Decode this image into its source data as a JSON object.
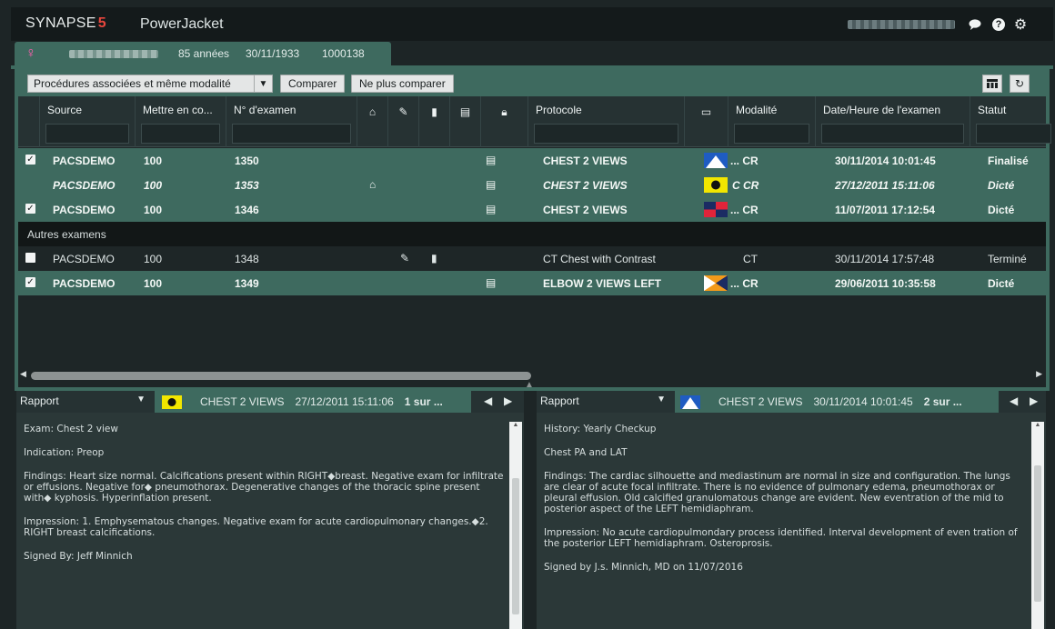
{
  "header": {
    "logo_text": "SYNAPSE",
    "logo_accent": "5",
    "app_name": "PowerJacket",
    "icons": [
      "chat-icon",
      "help-icon",
      "gear-icon"
    ]
  },
  "patient": {
    "age": "85 années",
    "dob": "30/11/1933",
    "id": "1000138"
  },
  "toolbar": {
    "filter_selected": "Procédures associées et même modalité",
    "compare_label": "Comparer",
    "no_compare_label": "Ne plus comparer"
  },
  "columns": {
    "source": "Source",
    "mettre": "Mettre en co...",
    "exam_no": "N° d'examen",
    "protocol": "Protocole",
    "modality": "Modalité",
    "datetime": "Date/Heure de l'examen",
    "status": "Statut"
  },
  "rows": [
    {
      "checked": true,
      "source": "PACSDEMO",
      "mettre": "100",
      "exam": "1350",
      "protocol": "CHEST 2 VIEWS",
      "modality": "... CR",
      "date": "30/11/2014 10:01:45",
      "status": "Finalisé"
    },
    {
      "checked": false,
      "source": "PACSDEMO",
      "mettre": "100",
      "exam": "1353",
      "protocol": "CHEST 2 VIEWS",
      "modality": "C CR",
      "date": "27/12/2011 15:11:06",
      "status": "Dicté"
    },
    {
      "checked": true,
      "source": "PACSDEMO",
      "mettre": "100",
      "exam": "1346",
      "protocol": "CHEST 2 VIEWS",
      "modality": "... CR",
      "date": "11/07/2011 17:12:54",
      "status": "Dicté"
    },
    {
      "checked": false,
      "source": "PACSDEMO",
      "mettre": "100",
      "exam": "1348",
      "protocol": "CT Chest with Contrast",
      "modality": "CT",
      "date": "30/11/2014 17:57:48",
      "status": "Terminé"
    },
    {
      "checked": true,
      "source": "PACSDEMO",
      "mettre": "100",
      "exam": "1349",
      "protocol": "ELBOW 2 VIEWS LEFT",
      "modality": "... CR",
      "date": "29/06/2011 10:35:58",
      "status": "Dicté"
    }
  ],
  "other_exams_label": "Autres examens",
  "report_left": {
    "type": "Rapport",
    "protocol": "CHEST 2 VIEWS",
    "date": "27/12/2011 15:11:06",
    "count": "1 sur ...",
    "paragraphs": [
      "Exam: Chest 2 view",
      "Indication: Preop",
      "Findings: Heart size normal. Calcifications present within RIGHT◆breast. Negative exam for infiltrate or effusions. Negative for◆ pneumothorax. Degenerative changes of the thoracic spine present with◆ kyphosis. Hyperinflation present.",
      "Impression: 1. Emphysematous changes. Negative exam for acute cardiopulmonary changes.◆2. RIGHT breast calcifications.",
      "Signed By: Jeff Minnich"
    ]
  },
  "report_right": {
    "type": "Rapport",
    "protocol": "CHEST 2 VIEWS",
    "date": "30/11/2014 10:01:45",
    "count": "2 sur ...",
    "paragraphs": [
      "History: Yearly Checkup",
      "Chest PA and LAT",
      "Findings: The cardiac silhouette and mediastinum are normal in size and configuration. The lungs are clear of acute focal infiltrate. There is no evidence of pulmonary edema, pneumothorax or pleural effusion. Old calcified granulomatous change are evident. New eventration of the mid to posterior aspect of the LEFT hemidiaphram.",
      "Impression: No acute cardiopulmondary process identified. Interval development of even tration of the posterior LEFT hemidiaphram. Osteroprosis.",
      "Signed by J.s. Minnich, MD on 11/07/2016"
    ]
  }
}
